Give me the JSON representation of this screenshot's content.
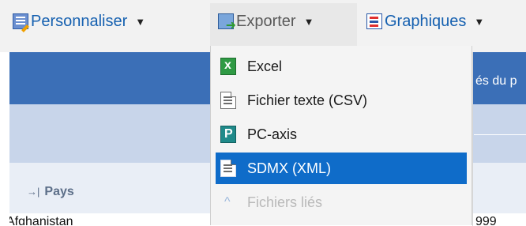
{
  "toolbar": {
    "customize_label": "Personnaliser",
    "export_label": "Exporter",
    "charts_label": "Graphiques",
    "caret": "▼"
  },
  "table": {
    "header_fragment": "és du p",
    "row_header_label": "Pays",
    "row_header_icon": "→|",
    "first_row_label": "Afghanistan",
    "first_row_value_fragment": "999"
  },
  "export_menu": {
    "items": [
      {
        "label": "Excel",
        "icon": "excel-icon",
        "state": "normal"
      },
      {
        "label": "Fichier texte (CSV)",
        "icon": "document-icon",
        "state": "normal"
      },
      {
        "label": "PC-axis",
        "icon": "pc-axis-icon",
        "state": "normal"
      },
      {
        "label": "SDMX (XML)",
        "icon": "document-icon",
        "state": "selected"
      },
      {
        "label": "Fichiers liés",
        "icon": "chevron-up-icon",
        "state": "disabled"
      }
    ]
  },
  "colors": {
    "accent": "#0f6cc9",
    "toolbar_link": "#1560b0",
    "header_dark": "#3b6fb7",
    "header_light": "#c8d5ea"
  }
}
